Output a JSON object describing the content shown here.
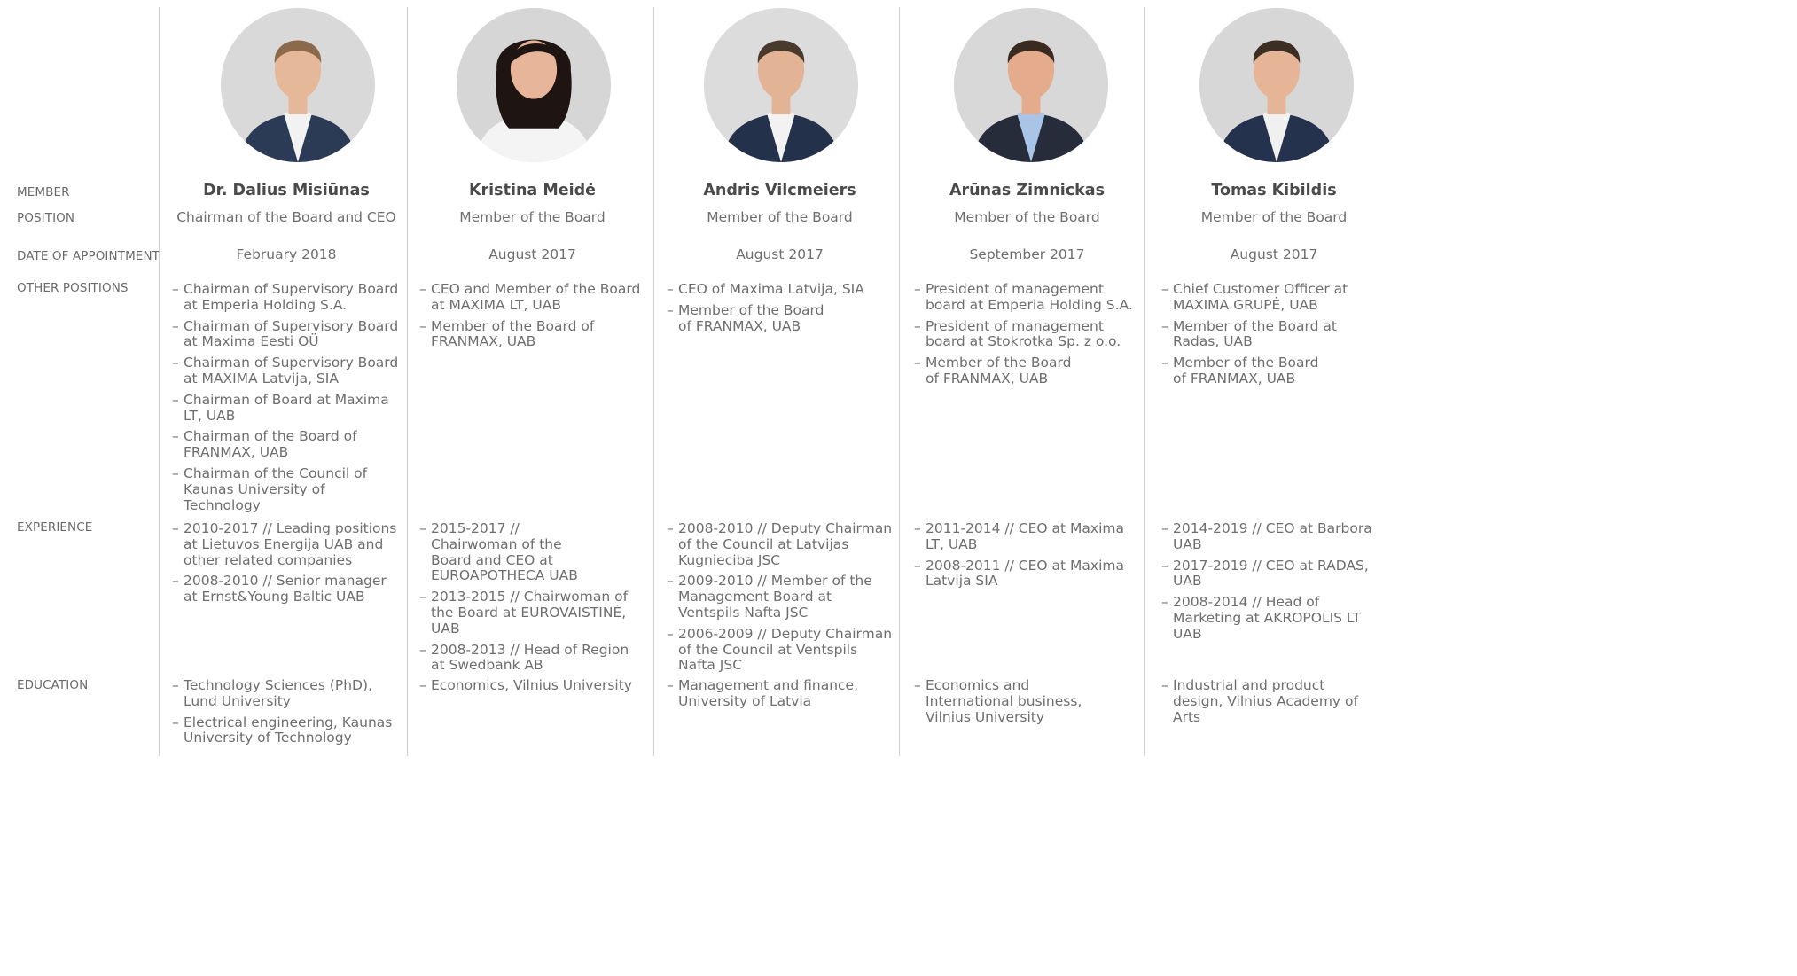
{
  "row_labels": {
    "member": "MEMBER",
    "position": "POSITION",
    "date": "DATE OF APPOINTMENT",
    "other_positions": "OTHER POSITIONS",
    "experience": "EXPERIENCE",
    "education": "EDUCATION"
  },
  "members": [
    {
      "name": "Dr. Dalius Misiūnas",
      "position": "Chairman of the Board and CEO",
      "date": "February 2018",
      "other_positions": [
        "Chairman of Supervisory Board at Emperia Holding S.A.",
        "Chairman of Supervisory Board at Maxima Eesti OÜ",
        "Chairman of Supervisory Board at MAXIMA Latvija, SIA",
        "Chairman of Board at Maxima LT, UAB",
        "Chairman of the Board of FRANMAX, UAB",
        "Chairman of the Council of Kaunas University of Technology"
      ],
      "experience": [
        "2010-2017 // Leading positions at Lietuvos Energija UAB and other related companies",
        "2008-2010 // Senior manager at Ernst&Young Baltic UAB"
      ],
      "education": [
        "Technology Sciences (PhD), Lund University",
        "Electrical engineering, Kaunas University of Technology"
      ],
      "photo": {
        "bg": "#d9d9d9",
        "suit": "#2b3a55",
        "shirt": "#f2f2f2",
        "hair": "#8a6a4a",
        "skin": "#e6b89a"
      }
    },
    {
      "name": "Kristina Meidė",
      "position": "Member of the Board",
      "date": "August 2017",
      "other_positions": [
        "CEO and Member of the Board at MAXIMA LT, UAB",
        "Member of the Board of FRANMAX, UAB"
      ],
      "experience": [
        "2015-2017 // Chairwoman of the Board and CEO at EUROAPOTHECA UAB",
        "2013-2015 // Chairwoman of the Board at EUROVAISTINĖ, UAB",
        "2008-2013 // Head of Region at Swedbank AB"
      ],
      "education": [
        "Economics, Vilnius University"
      ],
      "photo": {
        "bg": "#d6d6d6",
        "suit": "#f4f4f4",
        "shirt": "#f4f4f4",
        "hair": "#1e1512",
        "skin": "#e7b59a"
      }
    },
    {
      "name": "Andris Vilcmeiers",
      "position": "Member of the Board",
      "date": "August 2017",
      "other_positions": [
        "CEO of Maxima Latvija, SIA",
        "Member of the Board of FRANMAX, UAB"
      ],
      "experience": [
        "2008-2010 // Deputy Chairman of the Council at Latvijas Kugnieciba JSC",
        "2009-2010 // Member of the Management Board at Ventspils Nafta JSC",
        "2006-2009 // Deputy Chairman of the Council at Ventspils Nafta JSC"
      ],
      "education": [
        "Management and finance, University of Latvia"
      ],
      "photo": {
        "bg": "#dcdcdc",
        "suit": "#24314a",
        "shirt": "#f2f2f2",
        "hair": "#4a3a2e",
        "skin": "#e3b395"
      }
    },
    {
      "name": "Arūnas Zimnickas",
      "position": "Member of the Board",
      "date": "September 2017",
      "other_positions": [
        "President of management board at Emperia Holding S.A.",
        "President of management board at Stokrotka Sp. z o.o.",
        "Member of the Board of FRANMAX, UAB"
      ],
      "experience": [
        "2011-2014 // CEO at Maxima LT, UAB",
        "2008-2011 // CEO at Maxima Latvija SIA"
      ],
      "education": [
        "Economics and International business, Vilnius University"
      ],
      "photo": {
        "bg": "#d8d8d8",
        "suit": "#262c3a",
        "shirt": "#a9c4e6",
        "hair": "#3a2a20",
        "skin": "#e4ac8c"
      }
    },
    {
      "name": "Tomas Kibildis",
      "position": "Member of the Board",
      "date": "August 2017",
      "other_positions": [
        "Chief Customer Officer at MAXIMA GRUPĖ, UAB",
        "Member of the Board at Radas, UAB",
        "Member of the Board of FRANMAX, UAB"
      ],
      "experience": [
        "2014-2019 // CEO at Barbora UAB",
        "2017-2019 // CEO at RADAS, UAB",
        "2008-2014 // Head of Marketing at AKROPOLIS LT UAB"
      ],
      "education": [
        "Industrial and product design, Vilnius Academy of Arts"
      ],
      "photo": {
        "bg": "#d7d7d7",
        "suit": "#25324e",
        "shirt": "#f0f0f0",
        "hair": "#3d2e24",
        "skin": "#e6b597"
      }
    }
  ]
}
